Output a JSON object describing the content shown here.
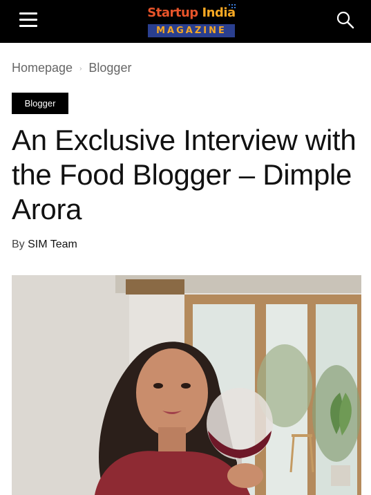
{
  "header": {
    "logo": {
      "line1_part1": "Startup ",
      "line1_part2": "India",
      "line2": "MAGAZINE"
    },
    "menu_icon": "hamburger-icon",
    "search_icon": "search-icon"
  },
  "breadcrumb": {
    "items": [
      "Homepage",
      "Blogger"
    ],
    "separator": "›"
  },
  "article": {
    "category": "Blogger",
    "title": "An Exclusive Interview with the Food Blogger – Dimple Arora",
    "byline_prefix": "By",
    "author": "SIM Team"
  },
  "colors": {
    "topbar": "#000000",
    "logo_orange": "#e8542a",
    "logo_yellow": "#f7a823",
    "logo_blue": "#2a3f8f"
  }
}
